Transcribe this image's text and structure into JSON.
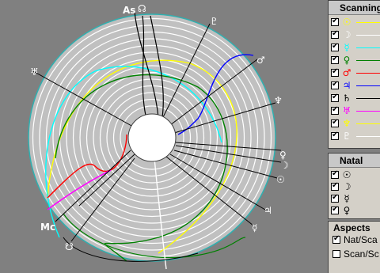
{
  "scanning_panel": {
    "title": "Scanning",
    "items": [
      {
        "glyph": "☉",
        "color": "#ffff00",
        "checked": true
      },
      {
        "glyph": "☽",
        "color": "#ffffff",
        "checked": true
      },
      {
        "glyph": "☿",
        "color": "#00ffff",
        "checked": true
      },
      {
        "glyph": "♀",
        "color": "#008000",
        "checked": true
      },
      {
        "glyph": "♂",
        "color": "#ff0000",
        "checked": true
      },
      {
        "glyph": "♃",
        "color": "#0000ff",
        "checked": true
      },
      {
        "glyph": "♄",
        "color": "#000000",
        "checked": true
      },
      {
        "glyph": "♅",
        "color": "#ff00ff",
        "checked": true
      },
      {
        "glyph": "♆",
        "color": "#ffff00",
        "checked": true
      },
      {
        "glyph": "♇",
        "color": "#ffffff",
        "checked": true
      }
    ]
  },
  "natal_panel": {
    "title": "Natal",
    "items": [
      {
        "glyph": "☉",
        "checked": true
      },
      {
        "glyph": "☽",
        "checked": true
      },
      {
        "glyph": "☿",
        "checked": true
      },
      {
        "glyph": "♀",
        "checked": true
      }
    ]
  },
  "aspects_panel": {
    "title": "Aspects",
    "options": [
      {
        "label": "Nat/Sca",
        "checked": true
      },
      {
        "label": "Scan/Sc",
        "checked": false
      }
    ]
  },
  "chart_labels": {
    "asc": "As",
    "node_top": "☊",
    "mc": "Mc",
    "node_bottom": "☋",
    "pluto": "♇",
    "mars": "♂",
    "neptune": "♆",
    "uranus": "♅",
    "venus": "♀",
    "moon": "☽",
    "sun": "☉",
    "jupiter": "♃",
    "mercury": "☿"
  },
  "colors": {
    "background": "#808080",
    "disc": "#c0c0c0",
    "ring_lines": "#ffffff",
    "panel": "#d4d0c8"
  }
}
